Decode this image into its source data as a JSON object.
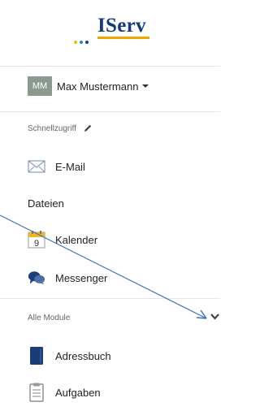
{
  "brand": {
    "name": "IServ",
    "dot_colors": [
      "#f2b600",
      "#2f7ec1",
      "#1c3f86"
    ],
    "underline_color": "#f0a500",
    "text_color": "#173a78"
  },
  "user": {
    "initials": "MM",
    "name": "Max Mustermann",
    "avatar_color": "#8a9a8f"
  },
  "quick_access": {
    "title": "Schnellzugriff",
    "items": [
      {
        "label": "E-Mail",
        "icon": "envelope-icon"
      },
      {
        "label": "Dateien",
        "icon": ""
      },
      {
        "label": "Kalender",
        "icon": "calendar-icon",
        "icon_text": "9"
      },
      {
        "label": "Messenger",
        "icon": "chat-bubbles-icon"
      }
    ]
  },
  "all_modules": {
    "title": "Alle Module",
    "items": [
      {
        "label": "Adressbuch",
        "icon": "address-book-icon"
      },
      {
        "label": "Aufgaben",
        "icon": "clipboard-icon"
      }
    ]
  },
  "annotation": {
    "arrow_color": "#3b6fb6"
  }
}
